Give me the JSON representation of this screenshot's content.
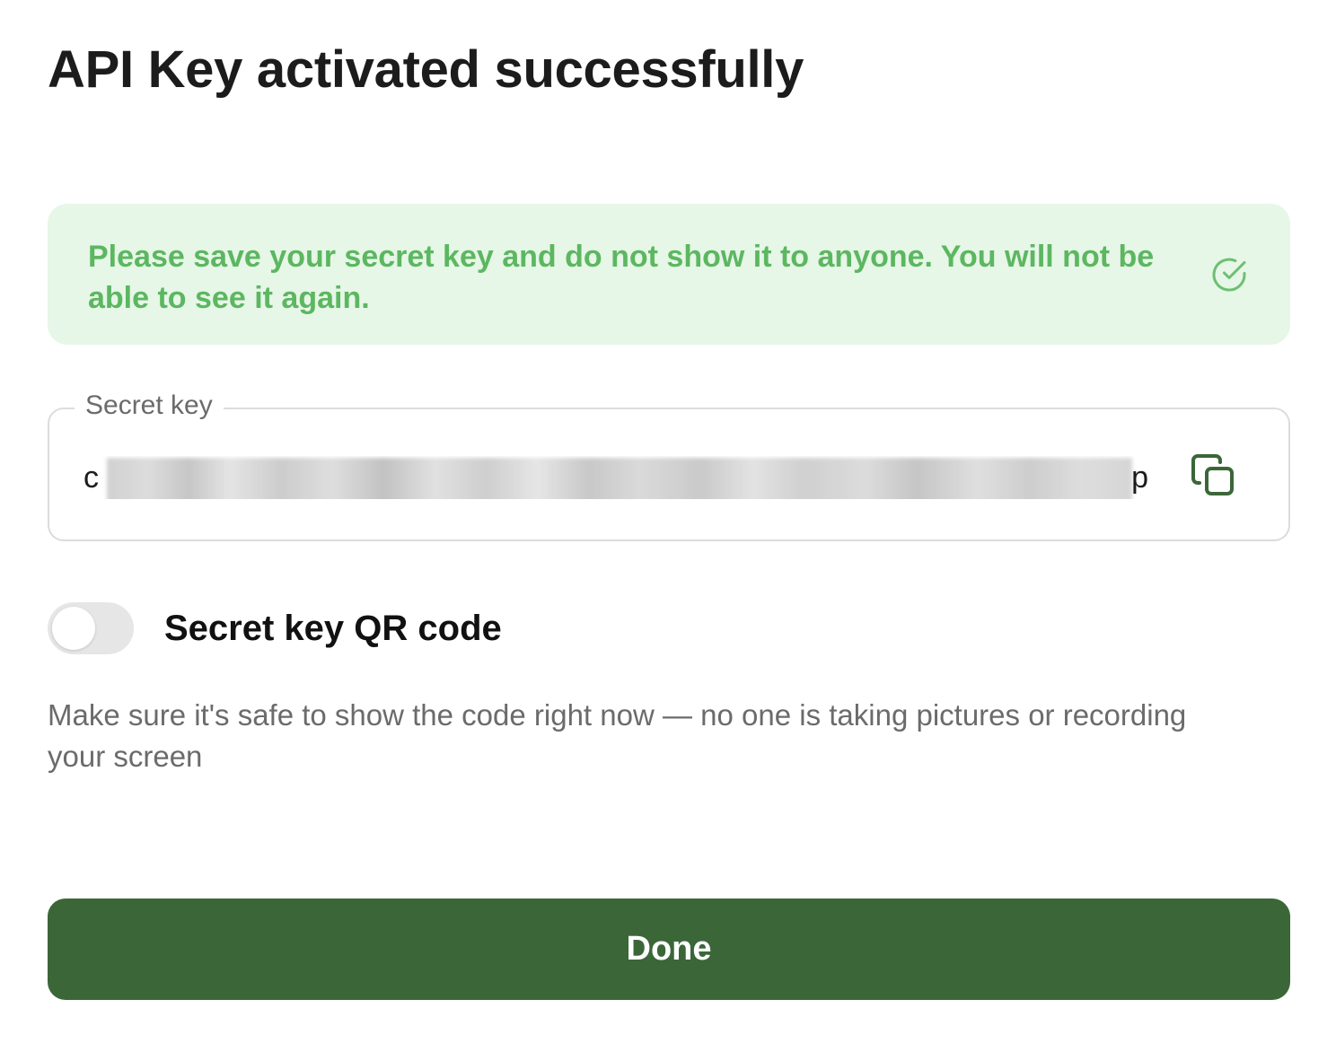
{
  "dialog": {
    "title": "API Key activated successfully"
  },
  "notice": {
    "text": "Please save your secret key and do not show it to anyone. You will not be able to see it again.",
    "icon": "check-circle-icon",
    "background_color": "#e6f6e7",
    "text_color": "#5cb760"
  },
  "secret_key": {
    "label": "Secret key",
    "value_first_char": "c",
    "value_last_char": "p",
    "value_masked": true,
    "copy_icon": "copy-icon"
  },
  "qr_toggle": {
    "label": "Secret key QR code",
    "enabled": false,
    "hint": "Make sure it's safe to show the code right now — no one is taking pictures or recording your screen"
  },
  "actions": {
    "done_label": "Done",
    "done_color": "#3b6738"
  }
}
